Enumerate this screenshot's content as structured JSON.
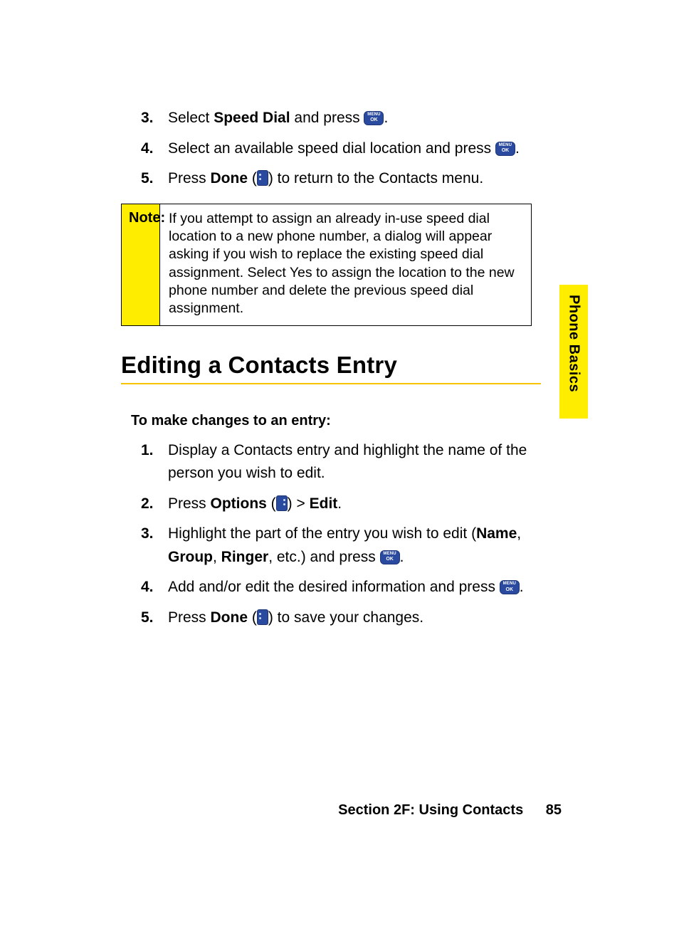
{
  "side_tab": {
    "label": "Phone Basics"
  },
  "top_steps": [
    {
      "num": "3.",
      "segments": [
        {
          "t": "Select "
        },
        {
          "t": "Speed Dial",
          "bold": true
        },
        {
          "t": " and press "
        },
        {
          "icon": "menuok"
        },
        {
          "t": "."
        }
      ]
    },
    {
      "num": "4.",
      "segments": [
        {
          "t": "Select an available speed dial location and press "
        },
        {
          "icon": "menuok"
        },
        {
          "t": "."
        }
      ]
    },
    {
      "num": "5.",
      "segments": [
        {
          "t": "Press "
        },
        {
          "t": "Done",
          "bold": true
        },
        {
          "t": " ("
        },
        {
          "icon": "softkey-left"
        },
        {
          "t": ") to return to the Contacts menu."
        }
      ]
    }
  ],
  "note": {
    "label": "Note:",
    "body": "If you attempt to assign an already in-use speed dial location to a new phone number, a dialog will appear asking if you wish to replace the existing speed dial assignment. Select Yes to assign the location to the new phone number and delete the previous speed dial assignment."
  },
  "heading": "Editing a Contacts Entry",
  "subheading": "To make changes to an entry:",
  "edit_steps": [
    {
      "num": "1.",
      "segments": [
        {
          "t": "Display a Contacts entry and highlight the name of the person you wish to edit."
        }
      ]
    },
    {
      "num": "2.",
      "segments": [
        {
          "t": "Press "
        },
        {
          "t": "Options",
          "bold": true
        },
        {
          "t": " ("
        },
        {
          "icon": "softkey-right"
        },
        {
          "t": ") > "
        },
        {
          "t": "Edit",
          "bold": true
        },
        {
          "t": "."
        }
      ]
    },
    {
      "num": "3.",
      "segments": [
        {
          "t": "Highlight the part of the entry you wish to edit ("
        },
        {
          "t": "Name",
          "bold": true
        },
        {
          "t": ", "
        },
        {
          "t": "Group",
          "bold": true
        },
        {
          "t": ", "
        },
        {
          "t": "Ringer",
          "bold": true
        },
        {
          "t": ", etc.) and press "
        },
        {
          "icon": "menuok"
        },
        {
          "t": "."
        }
      ]
    },
    {
      "num": "4.",
      "segments": [
        {
          "t": "Add and/or edit the desired information and press "
        },
        {
          "icon": "menuok"
        },
        {
          "t": "."
        }
      ]
    },
    {
      "num": "5.",
      "segments": [
        {
          "t": "Press "
        },
        {
          "t": "Done",
          "bold": true
        },
        {
          "t": " ("
        },
        {
          "icon": "softkey-left"
        },
        {
          "t": ") to save your changes."
        }
      ]
    }
  ],
  "footer": {
    "section": "Section 2F: Using Contacts",
    "page": "85"
  }
}
